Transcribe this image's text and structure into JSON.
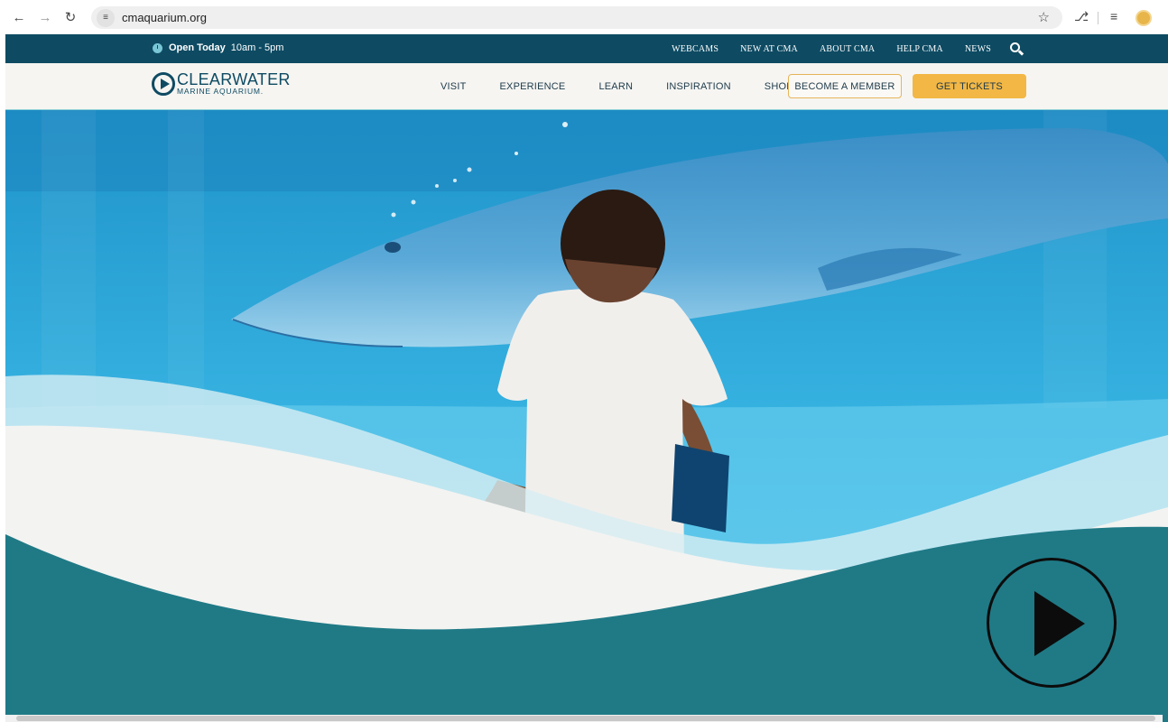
{
  "browser": {
    "url": "cmaquarium.org",
    "icons": [
      "back-arrow-icon",
      "forward-arrow-icon",
      "reload-icon",
      "site-settings-icon",
      "bookmark-star-icon",
      "extensions-icon",
      "reading-list-icon",
      "profile-avatar"
    ]
  },
  "topbar": {
    "hours_label": "Open Today",
    "hours_value": "10am - 5pm",
    "links": [
      "WEBCAMS",
      "NEW AT CMA",
      "ABOUT CMA",
      "HELP CMA",
      "NEWS"
    ]
  },
  "logo": {
    "line1": "CLEARWATER",
    "line2": "MARINE AQUARIUM."
  },
  "nav": {
    "items": [
      "VISIT",
      "EXPERIENCE",
      "LEARN",
      "INSPIRATION",
      "SHOP"
    ],
    "member_button": "BECOME A MEMBER",
    "tickets_button": "GET TICKETS"
  },
  "colors": {
    "topbar": "#0e4b63",
    "nav_bg": "#f6f5f2",
    "accent_gold": "#f2b745",
    "teal_wave": "#1f7a86",
    "water": "#2aa7d8"
  }
}
